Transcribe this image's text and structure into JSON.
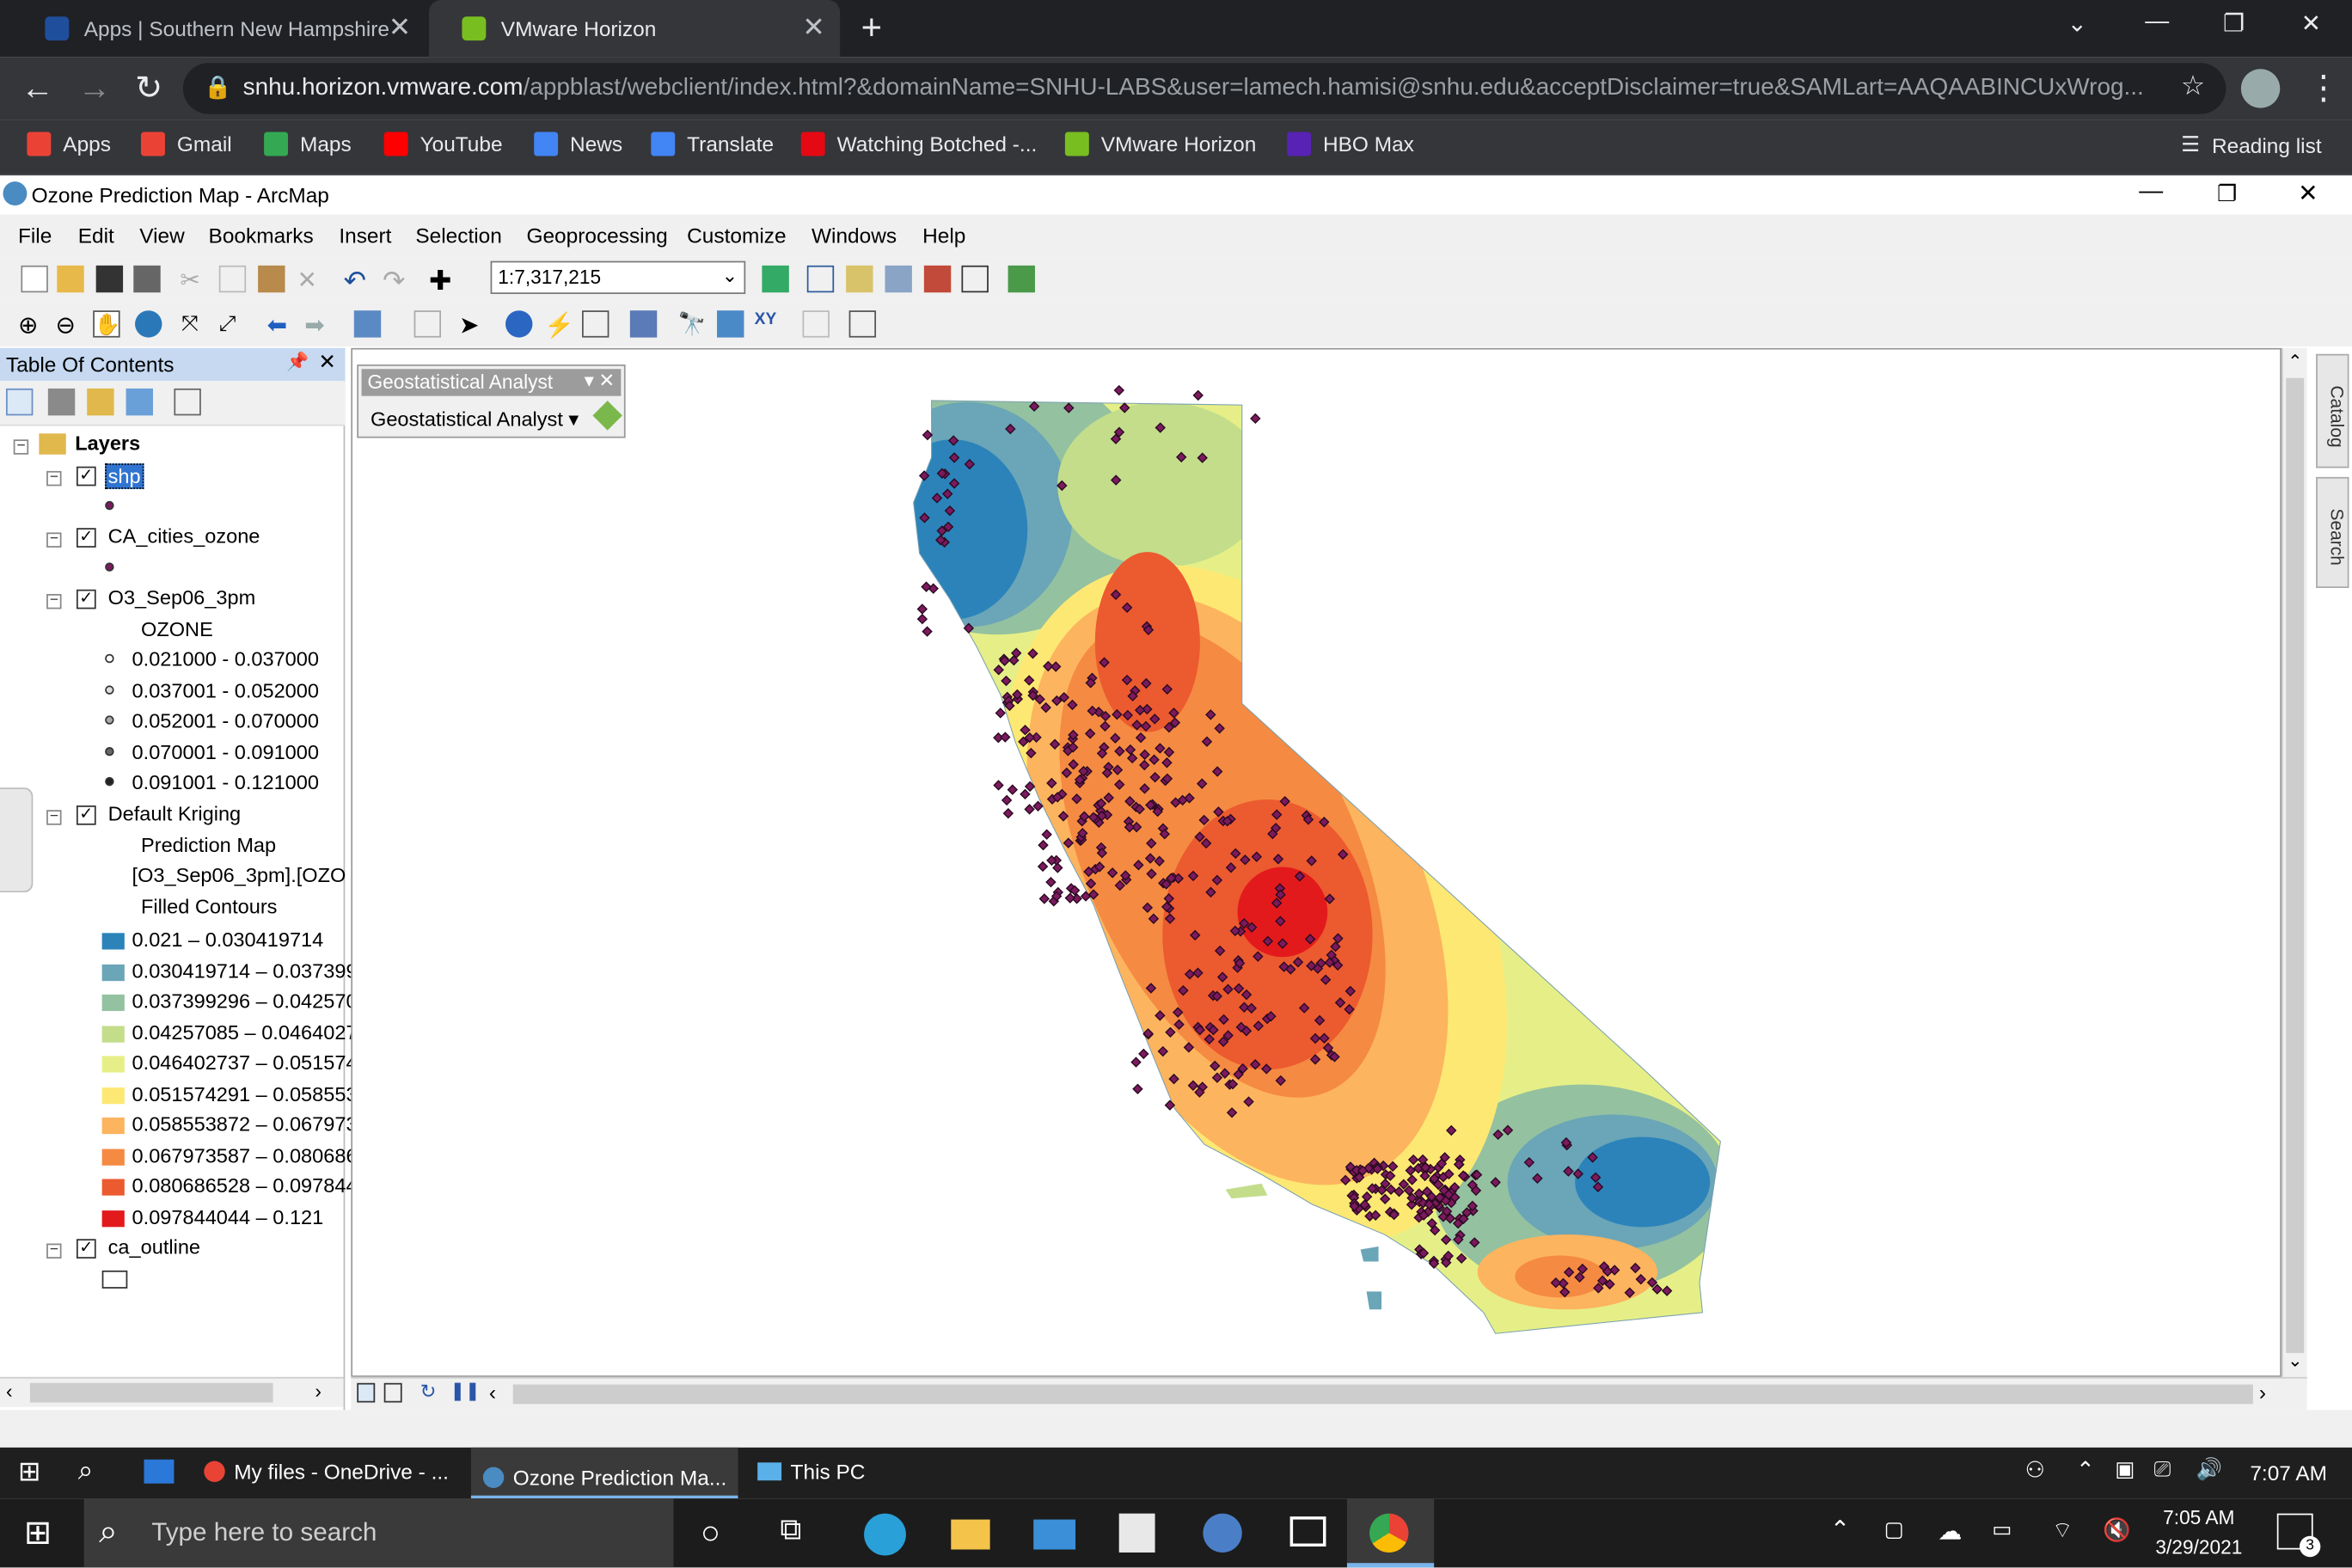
{
  "browser": {
    "tabs": [
      {
        "label": "Apps | Southern New Hampshire",
        "active": false
      },
      {
        "label": "VMware Horizon",
        "active": true
      }
    ],
    "url_host": "snhu.horizon.vmware.com",
    "url_rest": "/appblast/webclient/index.html?&domainName=SNHU-LABS&user=lamech.hamisi@snhu.edu&acceptDisclaimer=true&SAMLart=AAQAABINCUxWrog...",
    "bookmarks": [
      {
        "label": "Apps",
        "color": "#ea4335"
      },
      {
        "label": "Gmail",
        "color": "#ea4335"
      },
      {
        "label": "Maps",
        "color": "#34a853"
      },
      {
        "label": "YouTube",
        "color": "#ff0000"
      },
      {
        "label": "News",
        "color": "#4285f4"
      },
      {
        "label": "Translate",
        "color": "#4285f4"
      },
      {
        "label": "Watching Botched -...",
        "color": "#e50914"
      },
      {
        "label": "VMware Horizon",
        "color": "#78be20"
      },
      {
        "label": "HBO Max",
        "color": "#5822b4"
      }
    ],
    "reading_list": "Reading list"
  },
  "arcmap": {
    "title": "Ozone Prediction Map - ArcMap",
    "menu": [
      "File",
      "Edit",
      "View",
      "Bookmarks",
      "Insert",
      "Selection",
      "Geoprocessing",
      "Customize",
      "Windows",
      "Help"
    ],
    "scale": "1:7,317,215"
  },
  "toc": {
    "title": "Table Of Contents",
    "root": "Layers",
    "layers": {
      "shp": "shp",
      "cities": "CA_cities_ozone",
      "o3": "O3_Sep06_3pm",
      "o3_field": "OZONE",
      "o3_classes": [
        "0.021000 - 0.037000",
        "0.037001 - 0.052000",
        "0.052001 - 0.070000",
        "0.070001 - 0.091000",
        "0.091001 - 0.121000"
      ],
      "kriging": "Default Kriging",
      "kriging_sub1": "Prediction Map",
      "kriging_sub2": "[O3_Sep06_3pm].[OZO",
      "kriging_sub3": "Filled Contours",
      "kriging_classes": [
        {
          "label": "0.021 – 0.030419714",
          "color": "#2b83ba"
        },
        {
          "label": "0.030419714 – 0.037399",
          "color": "#6aa5b8"
        },
        {
          "label": "0.037399296 – 0.042570",
          "color": "#94c1a0"
        },
        {
          "label": "0.04257085 – 0.0464027",
          "color": "#c3dd8b"
        },
        {
          "label": "0.046402737 – 0.051574",
          "color": "#e6ef87"
        },
        {
          "label": "0.051574291 – 0.058553",
          "color": "#fde873"
        },
        {
          "label": "0.058553872 – 0.067973",
          "color": "#fdb45e"
        },
        {
          "label": "0.067973587 – 0.080686",
          "color": "#f58a42"
        },
        {
          "label": "0.080686528 – 0.097844",
          "color": "#ec5a2f"
        },
        {
          "label": "0.097844044 – 0.121",
          "color": "#e31a1c"
        }
      ],
      "outline": "ca_outline"
    }
  },
  "geostat": {
    "title": "Geostatistical Analyst",
    "button": "Geostatistical Analyst"
  },
  "side_tabs": [
    "Catalog",
    "Search"
  ],
  "vm_taskbar": {
    "items": [
      "My files - OneDrive - ...",
      "Ozone Prediction Ma...",
      "This PC"
    ],
    "time": "7:07 AM"
  },
  "win_taskbar": {
    "search_placeholder": "Type here to search",
    "time": "7:05 AM",
    "date": "3/29/2021",
    "notifications": "3"
  }
}
